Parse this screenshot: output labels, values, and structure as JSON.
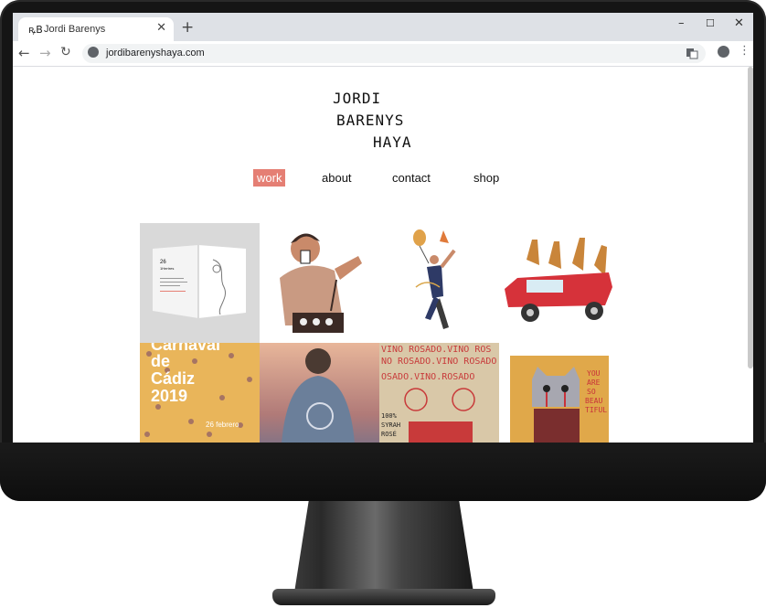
{
  "browser": {
    "tab_title": "Jordi Barenys",
    "tab_favicon": "ꝶB",
    "tab_close": "✕",
    "new_tab": "+",
    "window_controls": {
      "minimize": "–",
      "maximize": "☐",
      "close": "✕"
    },
    "nav": {
      "back": "←",
      "forward": "→",
      "reload": "↻"
    },
    "url": "jordibarenyshaya.com",
    "translate_icon": "translate-icon",
    "profile_icon": "account-icon",
    "menu_icon": "⋮"
  },
  "site": {
    "logo_lines": [
      "JORDI",
      "BARENYS",
      "HAYA"
    ],
    "menu": [
      "work",
      "about",
      "contact",
      "shop"
    ],
    "active_menu": "work",
    "accent_color": "#e57f74"
  },
  "gallery": {
    "tiles": [
      {
        "name": "tile-book-spread",
        "text_lines": [
          "26",
          "1Hertres"
        ]
      },
      {
        "name": "tile-sushi-chef"
      },
      {
        "name": "tile-dancer-balloon"
      },
      {
        "name": "tile-giraffes-red-car"
      },
      {
        "name": "tile-carnaval-cadiz",
        "text_lines": [
          "Carnaval",
          "de",
          "Cádiz",
          "2019",
          "26 febrero"
        ]
      },
      {
        "name": "tile-woman-sunset"
      },
      {
        "name": "tile-vino-rosado",
        "text_lines": [
          "VINO ROSADO.VINO ROS",
          "NO ROSADO.VINO ROSADO",
          "OSADO.VINO.ROSADO",
          "100%",
          "SYRAH",
          "ROSÉ"
        ]
      },
      {
        "name": "tile-cat-beautiful",
        "text_lines": [
          "YOU",
          "ARE",
          "SO",
          "BEAU",
          "TIFUL"
        ]
      }
    ]
  }
}
